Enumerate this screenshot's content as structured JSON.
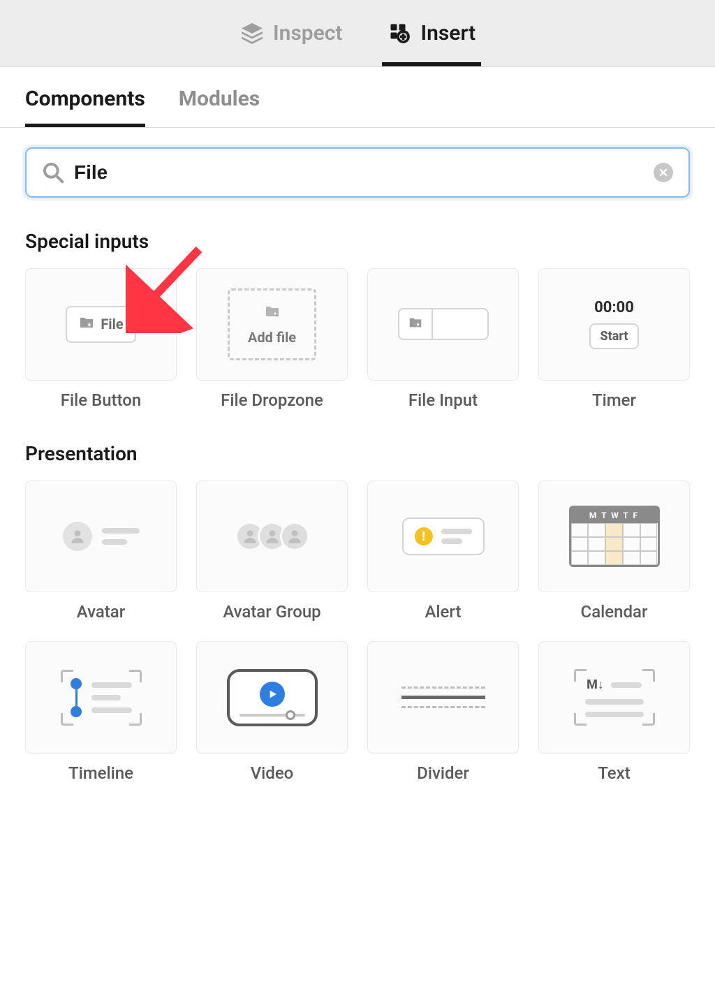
{
  "top_tabs": {
    "inspect": "Inspect",
    "insert": "Insert",
    "active": "insert"
  },
  "sub_tabs": {
    "components": "Components",
    "modules": "Modules",
    "active": "components"
  },
  "search": {
    "value": "File"
  },
  "sections": {
    "special_inputs": {
      "title": "Special inputs",
      "items": [
        {
          "label": "File Button",
          "thumb_text": "File"
        },
        {
          "label": "File Dropzone",
          "thumb_text": "Add file"
        },
        {
          "label": "File Input"
        },
        {
          "label": "Timer",
          "time": "00:00",
          "start": "Start"
        }
      ]
    },
    "presentation": {
      "title": "Presentation",
      "items": [
        {
          "label": "Avatar"
        },
        {
          "label": "Avatar Group"
        },
        {
          "label": "Alert"
        },
        {
          "label": "Calendar",
          "days": "M T W T F"
        },
        {
          "label": "Timeline"
        },
        {
          "label": "Video"
        },
        {
          "label": "Divider"
        },
        {
          "label": "Text",
          "md": "M↓"
        }
      ]
    }
  }
}
